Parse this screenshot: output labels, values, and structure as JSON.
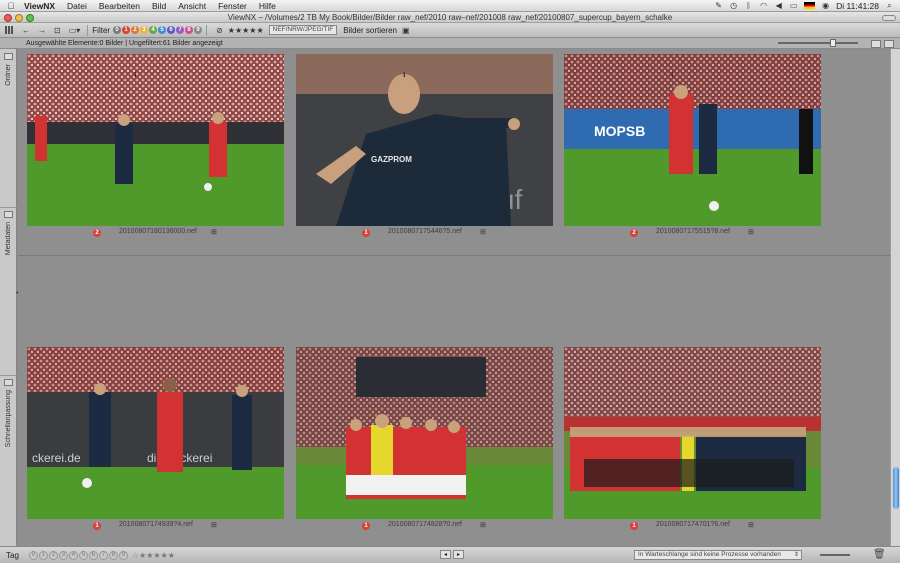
{
  "menubar": {
    "app": "ViewNX",
    "items": [
      "Datei",
      "Bearbeiten",
      "Bild",
      "Ansicht",
      "Fenster",
      "Hilfe"
    ],
    "clock": "Di 11:41:28"
  },
  "window": {
    "title": "ViewNX – /Volumes/2 TB My Book/Bilder/Bilder raw_nef/2010 raw–nef/201008 raw_nef/20100807_supercup_bayern_schalke"
  },
  "toolbar": {
    "filter_label": "Filter",
    "label_numbers": [
      "0",
      "1",
      "2",
      "3",
      "4",
      "5",
      "6",
      "7",
      "8",
      "9"
    ],
    "label_colors": [
      "#7a7a7a",
      "#d9403a",
      "#e27a2b",
      "#e3b93b",
      "#6aa845",
      "#3f8fd6",
      "#5a5ac8",
      "#9a5ac0",
      "#c8508d",
      "#8a8a8a"
    ],
    "stars": "★★★★★",
    "format_select": "NEF/NRW/JPEG/TIF",
    "sort_label": "Bilder sortieren"
  },
  "infobar": {
    "text": "Ausgewählte Elemente:0 Bilder | Ungefiltert:61 Bilder angezeigt"
  },
  "sidebar": {
    "panels": [
      "Ordner",
      "Metadaten",
      "Schnellanpassung"
    ]
  },
  "thumbnails": [
    {
      "label": "2",
      "filename": "20100807180136000.nef"
    },
    {
      "label": "1",
      "filename": "20100807175446?5.nef"
    },
    {
      "label": "2",
      "filename": "20100807175515?8.nef"
    },
    {
      "label": "1",
      "filename": "20100807174939?4.nef"
    },
    {
      "label": "1",
      "filename": "20100807174828?0.nef"
    },
    {
      "label": "1",
      "filename": "20100807174701?6.nef"
    }
  ],
  "bottombar": {
    "tag_label": "Tag",
    "label_numbers": [
      "0",
      "1",
      "2",
      "3",
      "4",
      "5",
      "6",
      "7",
      "8",
      "9"
    ],
    "stars": "☆★★★★★",
    "queue_text": "In Warteschlange sind keine Prozesse vorhanden"
  }
}
